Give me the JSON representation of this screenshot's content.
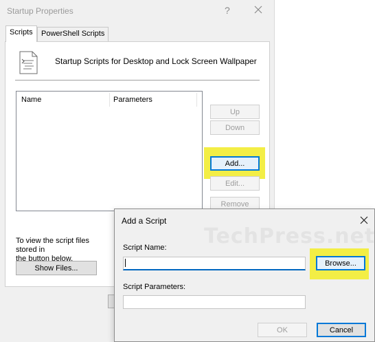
{
  "properties_dialog": {
    "title": "Startup Properties",
    "help_glyph": "?",
    "tabs": [
      {
        "label": "Scripts",
        "active": true
      },
      {
        "label": "PowerShell Scripts",
        "active": false
      }
    ],
    "heading": "Startup Scripts for Desktop and Lock Screen Wallpaper",
    "list_columns": [
      "Name",
      "Parameters"
    ],
    "buttons": {
      "up": "Up",
      "down": "Down",
      "add": "Add...",
      "edit": "Edit...",
      "remove": "Remove",
      "show_files": "Show Files..."
    },
    "files_text_line1": "To view the script files stored in",
    "files_text_line2": "the button below."
  },
  "add_script_dialog": {
    "title": "Add a Script",
    "watermark": "TechPress.net",
    "script_name_label": "Script Name:",
    "script_name_value": "",
    "browse_label": "Browse...",
    "script_parameters_label": "Script Parameters:",
    "script_parameters_value": "",
    "ok_label": "OK",
    "cancel_label": "Cancel"
  },
  "colors": {
    "highlight": "#f3ee45",
    "dialog_bg": "#f0f0f0",
    "focus_blue": "#0078d7"
  }
}
